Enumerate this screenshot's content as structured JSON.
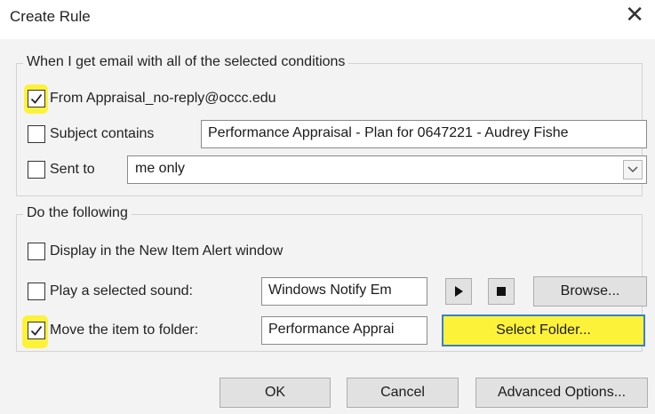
{
  "dialog": {
    "title": "Create Rule",
    "close_glyph": "✕"
  },
  "conditions": {
    "legend": "When I get email with all of the selected conditions",
    "from": {
      "label": "From Appraisal_no-reply@occc.edu",
      "checked": true
    },
    "subject": {
      "label": "Subject contains",
      "checked": false,
      "value": "Performance Appraisal - Plan for 0647221 - Audrey Fishe"
    },
    "sent_to": {
      "label": "Sent to",
      "checked": false,
      "value": "me only"
    }
  },
  "actions": {
    "legend": "Do the following",
    "alert": {
      "label": "Display in the New Item Alert window",
      "checked": false
    },
    "sound": {
      "label": "Play a selected sound:",
      "checked": false,
      "value": "Windows Notify Em",
      "browse_label": "Browse..."
    },
    "move": {
      "label": "Move the item to folder:",
      "checked": true,
      "value": "Performance Apprai",
      "select_folder_label": "Select Folder..."
    }
  },
  "footer": {
    "ok_label": "OK",
    "cancel_label": "Cancel",
    "advanced_label": "Advanced Options..."
  },
  "colors": {
    "highlight": "#fdf23a",
    "focus_border": "#3a7fc9",
    "dialog_bg": "#f3f3f3"
  },
  "icons": [
    "close-icon",
    "checkmark-icon",
    "chevron-down-icon",
    "play-icon",
    "stop-icon"
  ]
}
